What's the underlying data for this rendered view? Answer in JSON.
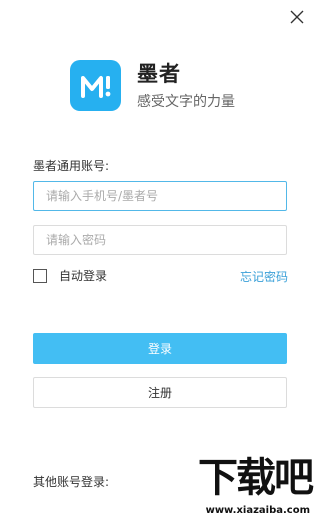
{
  "app": {
    "name": "墨者",
    "slogan": "感受文字的力量"
  },
  "form": {
    "account_label": "墨者通用账号:",
    "account_placeholder": "请输入手机号/墨者号",
    "password_placeholder": "请输入密码",
    "auto_login_label": "自动登录",
    "auto_login_checked": false,
    "forgot_password": "忘记密码",
    "login_button": "登录",
    "register_button": "注册",
    "other_accounts_label": "其他账号登录:"
  },
  "watermark": {
    "text": "下载吧",
    "url": "www.xiazaiba.com"
  },
  "colors": {
    "brand": "#26b0f0",
    "login_button": "#43bef3",
    "link": "#3aa0d8",
    "focus_border": "#52b8e8"
  },
  "icons": {
    "close": "close-icon",
    "logo": "mozhe-logo-icon"
  }
}
